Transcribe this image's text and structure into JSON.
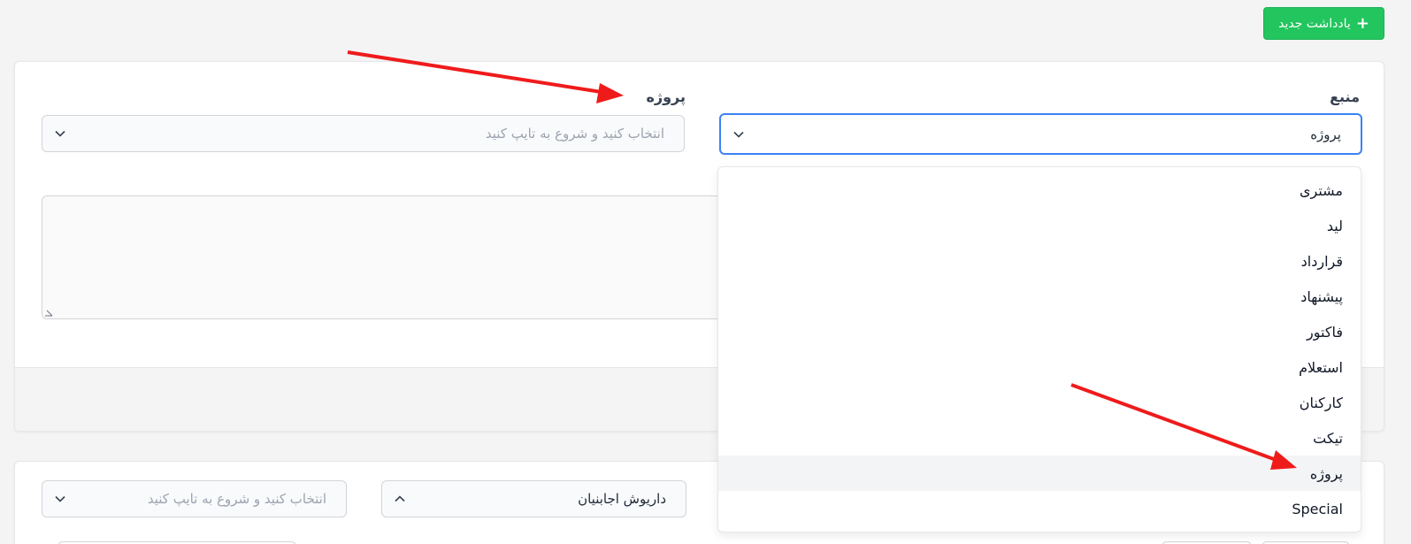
{
  "header": {
    "new_note_label": "یادداشت جدید",
    "new_note_icon": "plus-icon"
  },
  "form": {
    "source_label": "منبع",
    "source_value": "پروژه",
    "project_label": "پروژه",
    "project_placeholder": "انتخاب کنید و شروع به تایپ کنید",
    "note_text": ""
  },
  "source_dropdown": {
    "options": [
      "مشتری",
      "لید",
      "قرارداد",
      "پیشنهاد",
      "فاکتور",
      "استعلام",
      "کارکنان",
      "تیکت",
      "پروژه",
      "Special"
    ],
    "highlighted_index": 8
  },
  "filters": {
    "user_value": "داریوش اجابنیان",
    "second_placeholder": "انتخاب کنید و شروع به تایپ کنید"
  },
  "colors": {
    "accent_green": "#22c55e",
    "focus_blue": "#3b82f6",
    "annotation_red": "#ef1b1b"
  }
}
